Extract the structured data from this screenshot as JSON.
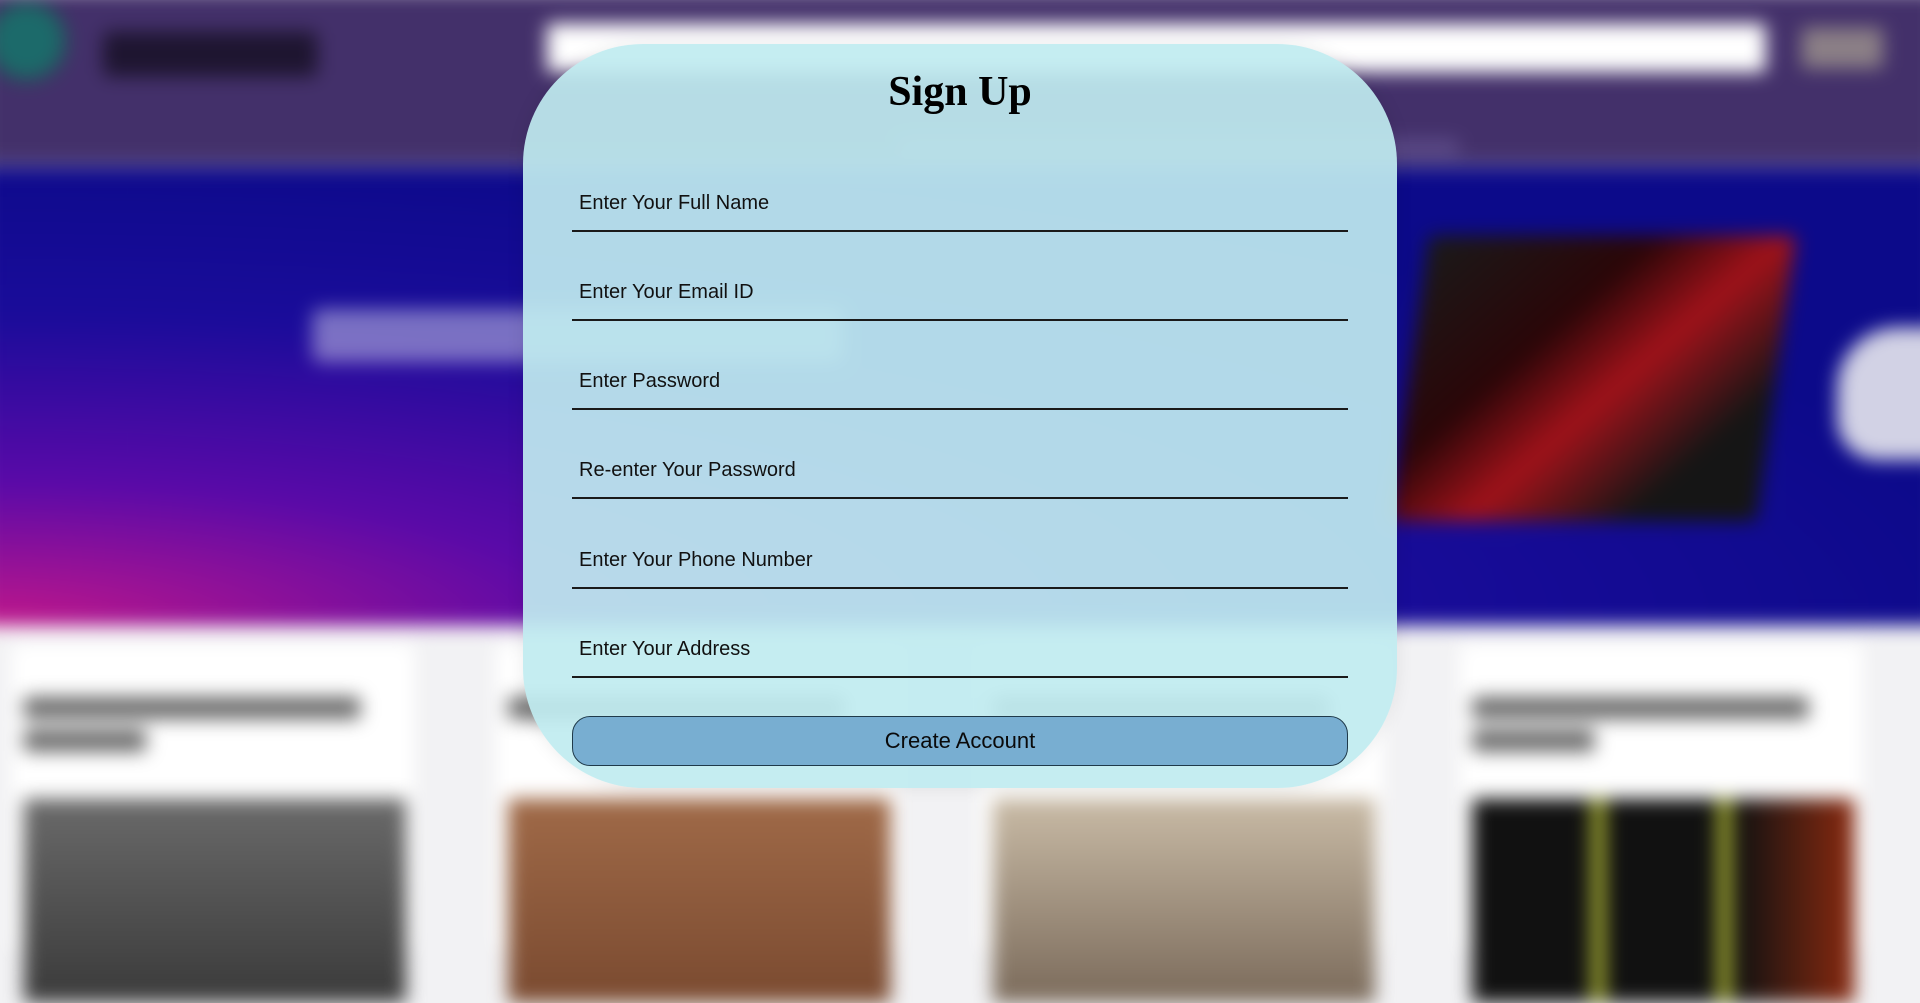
{
  "modal": {
    "title": "Sign Up",
    "fields": [
      {
        "name": "full-name-field",
        "type": "text",
        "value": "",
        "placeholder": "Enter Your Full Name"
      },
      {
        "name": "email-field",
        "type": "email",
        "value": "",
        "placeholder": "Enter Your Email ID"
      },
      {
        "name": "password-field",
        "type": "password",
        "value": "",
        "placeholder": "Enter Password"
      },
      {
        "name": "confirm-password-field",
        "type": "password",
        "value": "",
        "placeholder": "Re-enter Your Password"
      },
      {
        "name": "phone-field",
        "type": "tel",
        "value": "",
        "placeholder": "Enter Your Phone Number"
      },
      {
        "name": "address-field",
        "type": "text",
        "value": "",
        "placeholder": "Enter Your Address"
      }
    ],
    "submit_label": "Create Account"
  },
  "colors": {
    "modal_background": "#c0ecf0",
    "button_background": "#78aed1",
    "header_background": "#43306a",
    "banner_background": "#0c0a8a"
  },
  "background": {
    "state": "blurred",
    "header_icons": [
      "logo-icon"
    ],
    "banner_images": [
      "laptop-image",
      "controller-image"
    ]
  }
}
